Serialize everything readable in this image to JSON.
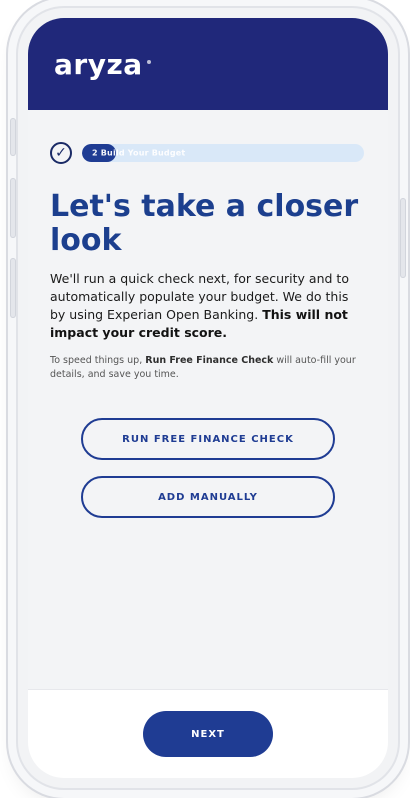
{
  "header": {
    "brand": "aryza"
  },
  "progress": {
    "label": "2 Build Your Budget",
    "fraction": 0.12
  },
  "main": {
    "title": "Let's take a closer look",
    "body_intro": "We'll run a quick check next, for security and to automatically populate your budget. We do this by using Experian Open Banking.",
    "body_bold": "This will not impact your credit score.",
    "small_pre": "To speed things up,",
    "small_bold": "Run Free Finance Check",
    "small_post": "will auto-fill your details, and save you time."
  },
  "buttons": {
    "run_check": "RUN FREE FINANCE CHECK",
    "add_manually": "ADD MANUALLY",
    "next": "NEXT"
  },
  "colors": {
    "header_bg": "#20287a",
    "accent": "#1f3c93",
    "title": "#1c3f8e",
    "progress_track": "#d9e8f8"
  },
  "icons": {
    "step_check": "check-circle-icon"
  }
}
